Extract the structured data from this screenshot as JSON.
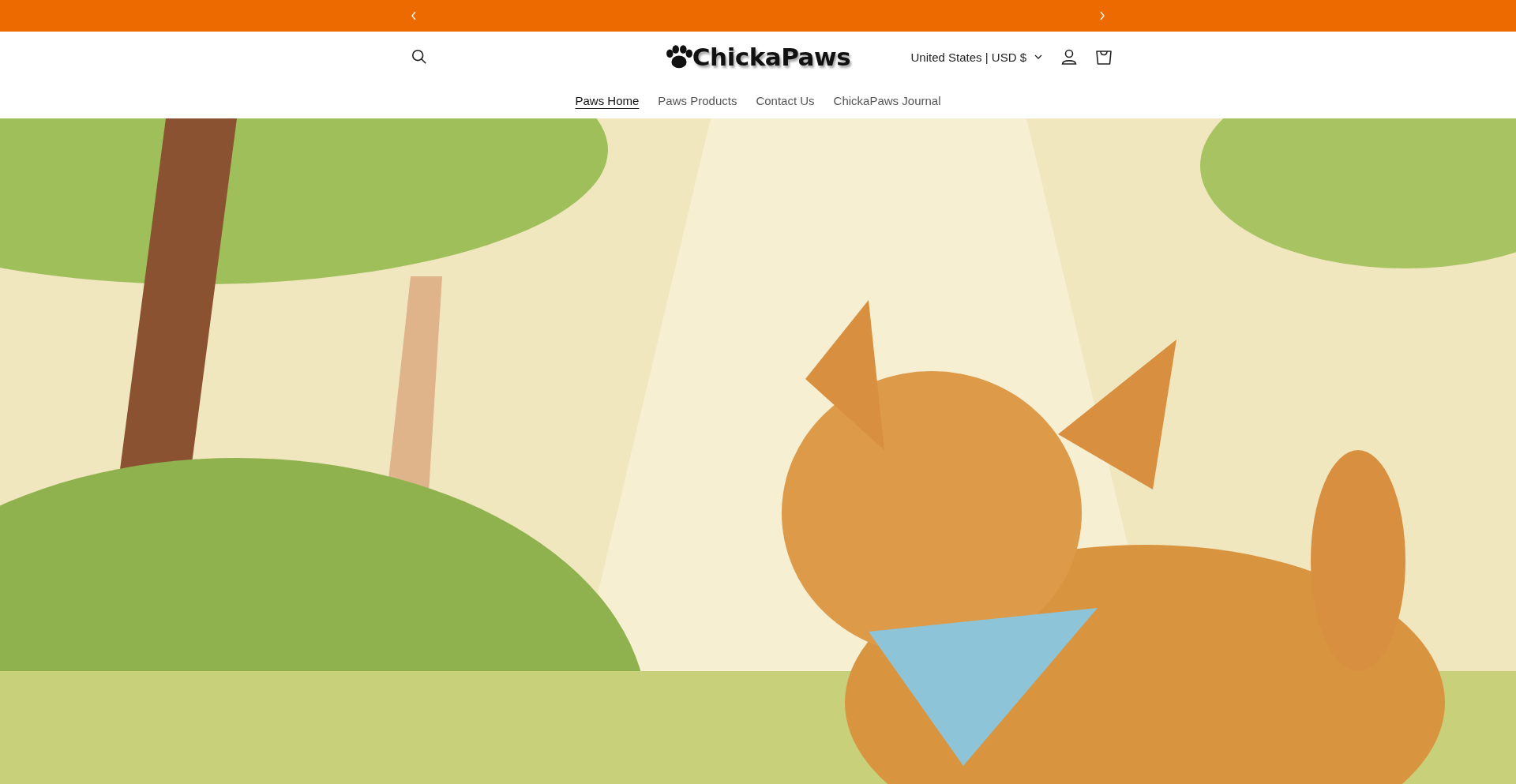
{
  "announcement_bar": {
    "has_prev": true,
    "has_next": true
  },
  "header": {
    "logo": "ChickaPaws",
    "locale": "United States | USD $"
  },
  "nav": [
    {
      "label": "Paws Home",
      "selected": true
    },
    {
      "label": "Paws Products",
      "selected": false
    },
    {
      "label": "Contact Us",
      "selected": false
    },
    {
      "label": "ChickaPaws Journal",
      "selected": false
    }
  ]
}
